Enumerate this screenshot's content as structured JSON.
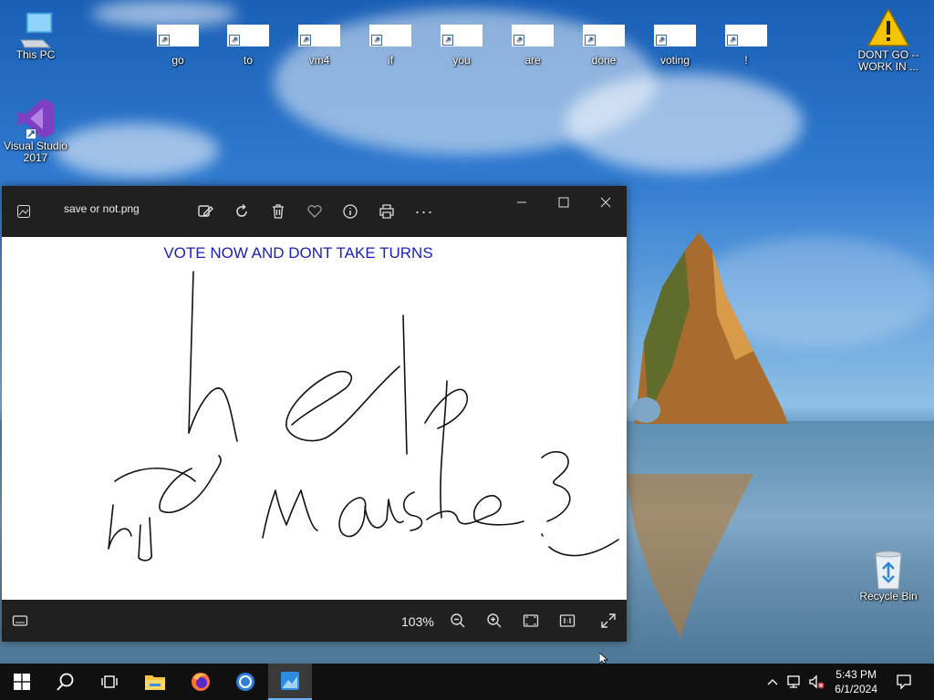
{
  "desktop": {
    "icons": [
      {
        "label": "This PC"
      },
      {
        "label": "Visual Studio 2017"
      },
      {
        "label": "DONT GO -- WORK IN ..."
      },
      {
        "label": "Recycle Bin"
      }
    ],
    "shortcuts": [
      "go",
      "to",
      "vm4",
      "if",
      "you",
      "are",
      "done",
      "voting",
      "!"
    ]
  },
  "viewer": {
    "filename": "save or not.png",
    "image_title": "VOTE NOW AND DONT TAKE TURNS",
    "zoom": "103%"
  },
  "taskbar": {
    "time": "5:43 PM",
    "date": "6/1/2024"
  },
  "colors": {
    "accent": "#6fb3f5",
    "image_text": "#1d1db8",
    "titlebar": "#202020"
  }
}
